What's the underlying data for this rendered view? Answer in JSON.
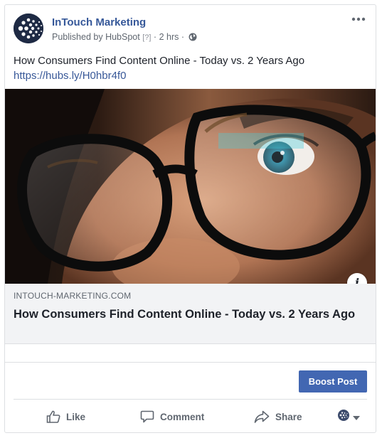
{
  "post": {
    "page_name": "InTouch Marketing",
    "published_prefix": "Published by",
    "publisher": "HubSpot",
    "publisher_help": "[?]",
    "separator": "·",
    "time": "2 hrs",
    "text": "How Consumers Find Content Online - Today vs. 2 Years Ago",
    "short_link": "https://hubs.ly/H0hbr4f0"
  },
  "link_preview": {
    "domain": "INTOUCH-MARKETING.COM",
    "title": "How Consumers Find Content Online - Today vs. 2 Years Ago",
    "info_label": "i"
  },
  "boost": {
    "label": "Boost Post",
    "color": "#4267b2"
  },
  "actions": {
    "like": "Like",
    "comment": "Comment",
    "share": "Share"
  },
  "colors": {
    "page_name": "#365899",
    "link": "#385898",
    "secondary_text": "#606770",
    "preview_bg": "#f2f3f5"
  },
  "icons": [
    "more-options-icon",
    "globe-icon",
    "info-icon",
    "like-icon",
    "comment-icon",
    "share-icon",
    "audience-globe-icon",
    "caret-down-icon"
  ]
}
